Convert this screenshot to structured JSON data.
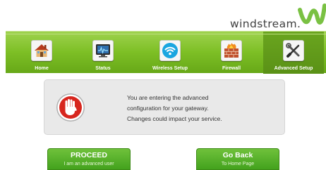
{
  "brand": {
    "name": "windstream."
  },
  "nav": {
    "items": [
      {
        "label": "Home",
        "icon": "home-icon"
      },
      {
        "label": "Status",
        "icon": "status-monitor-icon"
      },
      {
        "label": "Wireless Setup",
        "icon": "wireless-icon"
      },
      {
        "label": "Firewall",
        "icon": "firewall-icon"
      },
      {
        "label": "Advanced Setup",
        "icon": "tools-icon",
        "active": true
      }
    ]
  },
  "notice": {
    "icon": "stop-hand-icon",
    "lines": [
      "You are entering the advanced",
      "configuration for your gateway.",
      "Changes could impact your service."
    ]
  },
  "actions": {
    "proceed": {
      "title": "PROCEED",
      "subtitle": "I am an advanced user"
    },
    "back": {
      "title": "Go Back",
      "subtitle": "To Home Page"
    }
  },
  "colors": {
    "nav_green": "#7dbf25",
    "button_green": "#43a21d",
    "logo_green": "#7ac143",
    "stop_red": "#d7261e"
  }
}
